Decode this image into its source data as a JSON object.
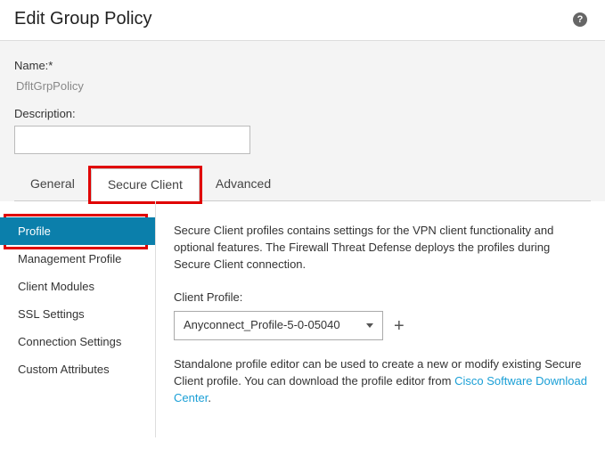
{
  "header": {
    "title": "Edit Group Policy"
  },
  "form": {
    "name_label": "Name:*",
    "name_value": "DfltGrpPolicy",
    "description_label": "Description:",
    "description_value": ""
  },
  "tabs": [
    {
      "label": "General"
    },
    {
      "label": "Secure Client"
    },
    {
      "label": "Advanced"
    }
  ],
  "sidebar": [
    {
      "label": "Profile"
    },
    {
      "label": "Management Profile"
    },
    {
      "label": "Client Modules"
    },
    {
      "label": "SSL Settings"
    },
    {
      "label": "Connection Settings"
    },
    {
      "label": "Custom Attributes"
    }
  ],
  "content": {
    "intro": "Secure Client profiles contains settings for the VPN client functionality and optional features. The Firewall Threat Defense deploys the profiles during Secure Client connection.",
    "profile_label": "Client Profile:",
    "profile_value": "Anyconnect_Profile-5-0-05040",
    "standalone_prefix": "Standalone profile editor can be used to create a new or modify existing Secure Client profile. You can download the profile editor from ",
    "link_text": "Cisco Software Download Center",
    "standalone_suffix": "."
  }
}
